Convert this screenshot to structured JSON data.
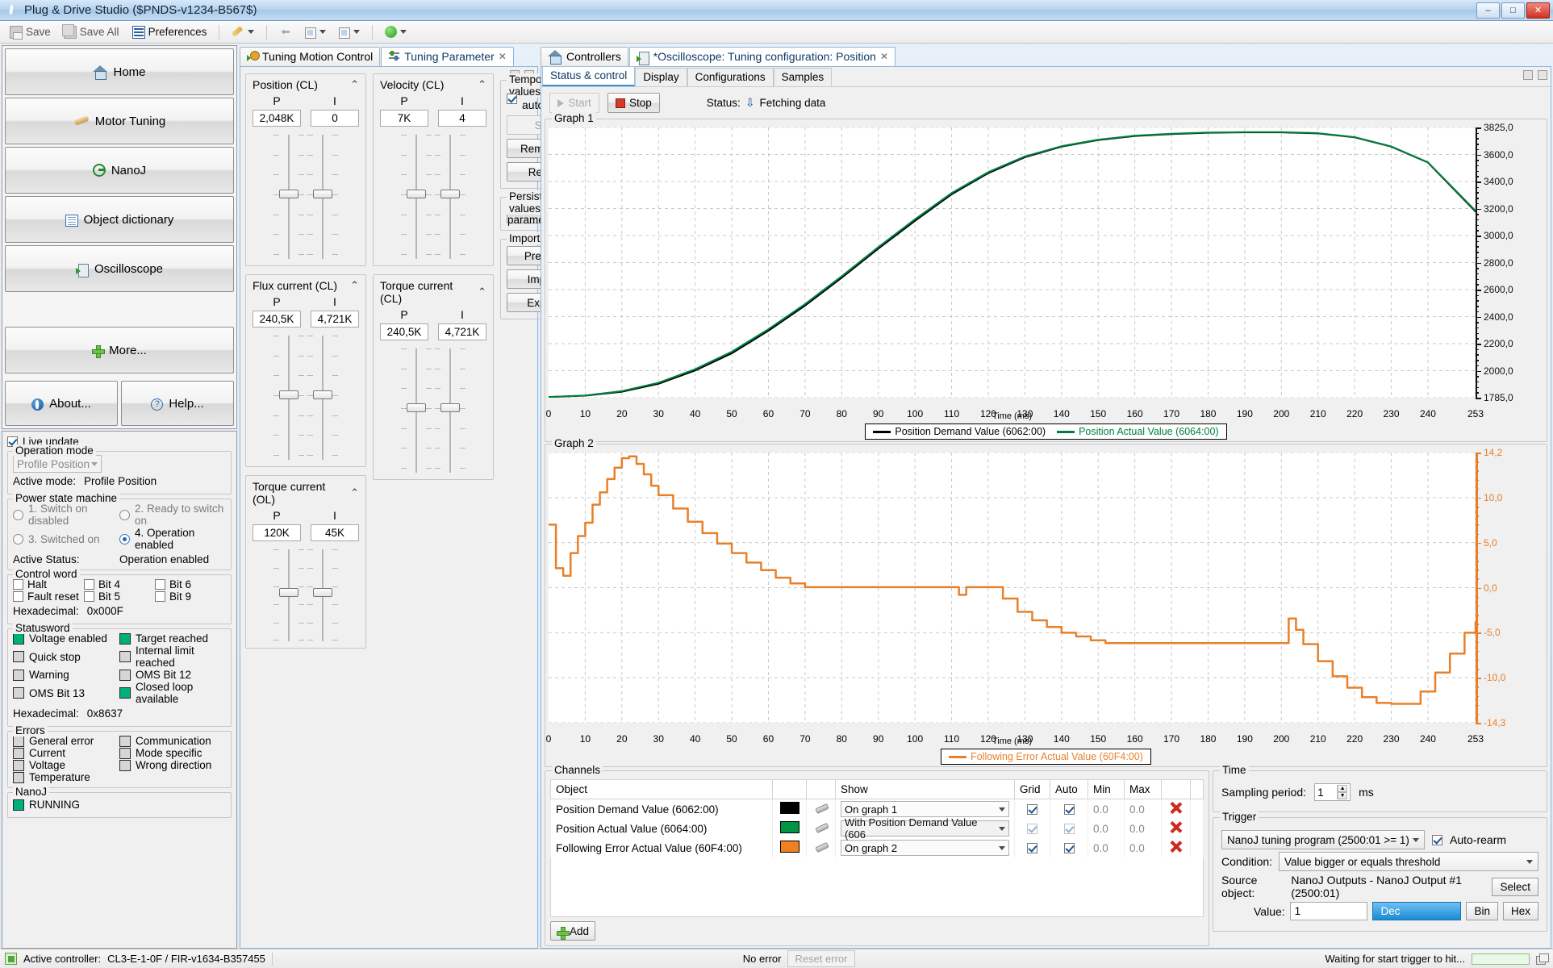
{
  "window": {
    "title": "Plug & Drive Studio ($PNDS-v1234-B567$)",
    "minimize": "–",
    "maximize": "□",
    "close": "✕"
  },
  "toolbar": {
    "save": "Save",
    "save_all": "Save All",
    "preferences": "Preferences"
  },
  "sidebar": {
    "items": [
      {
        "label": "Home",
        "icon": "home-icon"
      },
      {
        "label": "Motor Tuning",
        "icon": "wrench-icon"
      },
      {
        "label": "NanoJ",
        "icon": "nanoj-icon"
      },
      {
        "label": "Object dictionary",
        "icon": "dictionary-icon"
      },
      {
        "label": "Oscilloscope",
        "icon": "oscilloscope-icon"
      }
    ],
    "more": "More...",
    "about": "About...",
    "help": "Help..."
  },
  "state": {
    "live_update": "Live update",
    "operation_mode": {
      "legend": "Operation mode",
      "selected": "Profile Position",
      "active_mode_label": "Active mode:",
      "active_mode_value": "Profile Position"
    },
    "power_state": {
      "legend": "Power state machine",
      "options": [
        "1. Switch on disabled",
        "2. Ready to switch on",
        "3. Switched on",
        "4. Operation enabled"
      ],
      "selected_index": 3,
      "active_status_label": "Active Status:",
      "active_status_value": "Operation enabled"
    },
    "control_word": {
      "legend": "Control word",
      "items": [
        "Halt",
        "Bit 4",
        "Bit 6",
        "Fault reset",
        "Bit 5",
        "Bit 9"
      ],
      "hex_label": "Hexadecimal:",
      "hex_value": "0x000F"
    },
    "statusword": {
      "legend": "Statusword",
      "items": [
        {
          "label": "Voltage enabled",
          "on": true
        },
        {
          "label": "Target reached",
          "on": true
        },
        {
          "label": "Quick stop",
          "on": false
        },
        {
          "label": "Internal limit reached",
          "on": false
        },
        {
          "label": "Warning",
          "on": false
        },
        {
          "label": "OMS Bit 12",
          "on": false
        },
        {
          "label": "OMS Bit 13",
          "on": false
        },
        {
          "label": "Closed loop available",
          "on": true
        }
      ],
      "hex_label": "Hexadecimal:",
      "hex_value": "0x8637"
    },
    "errors": {
      "legend": "Errors",
      "items": [
        "General error",
        "Communication",
        "Current",
        "Mode specific",
        "Voltage",
        "Wrong direction",
        "Temperature"
      ]
    },
    "nanoj": {
      "legend": "NanoJ",
      "status": "RUNNING"
    }
  },
  "center_tabs": [
    {
      "label": "Tuning Motion Control",
      "active": false,
      "closable": false
    },
    {
      "label": "Tuning Parameter",
      "active": true,
      "closable": true
    }
  ],
  "tuning_groups": [
    {
      "title": "Position (CL)",
      "p_label": "P",
      "i_label": "I",
      "p_value": "2,048K",
      "i_value": "0"
    },
    {
      "title": "Velocity (CL)",
      "p_label": "P",
      "i_label": "I",
      "p_value": "7K",
      "i_value": "4"
    },
    {
      "title": "Flux current (CL)",
      "p_label": "P",
      "i_label": "I",
      "p_value": "240,5K",
      "i_value": "4,721K"
    },
    {
      "title": "Torque current (CL)",
      "p_label": "P",
      "i_label": "I",
      "p_value": "240,5K",
      "i_value": "4,721K"
    },
    {
      "title": "Torque current (OL)",
      "p_label": "P",
      "i_label": "I",
      "p_value": "120K",
      "i_value": "45K"
    }
  ],
  "side_actions": {
    "temporary": {
      "legend": "Temporary values",
      "send_auto": "Send automatically",
      "send": "Send",
      "remember": "Remember",
      "restore": "Restore"
    },
    "persistent": {
      "legend": "Persistent values",
      "save_parameters": "Save parameters"
    },
    "import_export": {
      "legend": "Import / Export",
      "presets": "Presets...",
      "import": "Import...",
      "export": "Export..."
    }
  },
  "osc_tabs": [
    {
      "label": "Controllers",
      "active": false,
      "closable": false
    },
    {
      "label": "*Oscilloscope: Tuning configuration: Position",
      "active": true,
      "closable": true
    }
  ],
  "osc_subtabs": [
    {
      "label": "Status & control",
      "active": true
    },
    {
      "label": "Display",
      "active": false
    },
    {
      "label": "Configurations",
      "active": false
    },
    {
      "label": "Samples",
      "active": false
    }
  ],
  "osc_controls": {
    "start": "Start",
    "stop": "Stop",
    "status_label": "Status:",
    "status_value": "Fetching data"
  },
  "chart_data": [
    {
      "type": "line",
      "title": "Graph 1",
      "xlabel": "Time (ms)",
      "ylabel": "",
      "xlim": [
        0,
        253
      ],
      "ylim": [
        1785.0,
        3825.0
      ],
      "xticks": [
        0,
        10,
        20,
        30,
        40,
        50,
        60,
        70,
        80,
        90,
        100,
        110,
        120,
        130,
        140,
        150,
        160,
        170,
        180,
        190,
        200,
        210,
        220,
        230,
        240,
        253
      ],
      "yticks": [
        "3825,0",
        "3600,0",
        "3400,0",
        "3200,0",
        "3000,0",
        "2800,0",
        "2600,0",
        "2400,0",
        "2200,0",
        "2000,0",
        "1785,0"
      ],
      "grid": true,
      "legend_position": "bottom",
      "series": [
        {
          "name": "Position Demand Value (6062:00)",
          "color": "#000000",
          "x": [
            0,
            10,
            20,
            30,
            40,
            50,
            60,
            70,
            80,
            90,
            100,
            110,
            120,
            130,
            140,
            150,
            160,
            170,
            180,
            190,
            200,
            210,
            220,
            230,
            240,
            253
          ],
          "y": [
            1790,
            1800,
            1830,
            1890,
            1990,
            2120,
            2290,
            2480,
            2690,
            2910,
            3120,
            3320,
            3480,
            3600,
            3680,
            3730,
            3760,
            3775,
            3785,
            3788,
            3788,
            3780,
            3750,
            3680,
            3560,
            3190
          ]
        },
        {
          "name": "Position Actual Value (6064:00)",
          "color": "#008040",
          "x": [
            0,
            10,
            20,
            30,
            40,
            50,
            60,
            70,
            80,
            90,
            100,
            110,
            120,
            130,
            140,
            150,
            160,
            170,
            180,
            190,
            200,
            210,
            220,
            230,
            240,
            253
          ],
          "y": [
            1790,
            1802,
            1835,
            1898,
            2000,
            2132,
            2302,
            2492,
            2702,
            2922,
            3132,
            3330,
            3488,
            3606,
            3684,
            3733,
            3763,
            3778,
            3787,
            3790,
            3790,
            3782,
            3752,
            3682,
            3562,
            3196
          ]
        }
      ]
    },
    {
      "type": "line",
      "title": "Graph 2",
      "xlabel": "Time (ms)",
      "ylabel": "",
      "xlim": [
        0,
        253
      ],
      "ylim": [
        -14.3,
        14.2
      ],
      "xticks": [
        0,
        10,
        20,
        30,
        40,
        50,
        60,
        70,
        80,
        90,
        100,
        110,
        120,
        130,
        140,
        150,
        160,
        170,
        180,
        190,
        200,
        210,
        220,
        230,
        240,
        253
      ],
      "yticks": [
        "14,2",
        "10,0",
        "5,0",
        "0,0",
        "-5,0",
        "-10,0",
        "-14,3"
      ],
      "grid": true,
      "legend_position": "bottom",
      "series": [
        {
          "name": "Following Error Actual Value (60F4:00)",
          "color": "#E8802A",
          "x": [
            0,
            2,
            4,
            6,
            8,
            10,
            12,
            14,
            16,
            18,
            20,
            22,
            24,
            26,
            28,
            30,
            34,
            38,
            42,
            46,
            50,
            54,
            58,
            62,
            66,
            70,
            74,
            78,
            82,
            86,
            90,
            100,
            110,
            112,
            114,
            120,
            124,
            128,
            132,
            136,
            140,
            144,
            148,
            152,
            160,
            170,
            180,
            190,
            200,
            202,
            204,
            206,
            210,
            214,
            218,
            222,
            226,
            230,
            234,
            238,
            242,
            246,
            250,
            253
          ],
          "y": [
            6.6,
            2.0,
            1.2,
            3.6,
            5.4,
            6.8,
            8.7,
            10.0,
            11.4,
            12.6,
            13.6,
            13.8,
            13.0,
            11.9,
            10.7,
            9.7,
            8.3,
            6.9,
            5.7,
            4.6,
            3.6,
            2.6,
            1.8,
            1.0,
            0.4,
            0.0,
            0.0,
            0.0,
            0.0,
            0.0,
            0.0,
            0.0,
            0.0,
            -0.8,
            0.0,
            0.0,
            -1.2,
            -2.6,
            -3.5,
            -4.2,
            -4.8,
            -5.2,
            -5.6,
            -5.9,
            -5.9,
            -5.9,
            -5.9,
            -5.9,
            -5.9,
            -3.3,
            -4.5,
            -6.0,
            -7.8,
            -9.4,
            -10.6,
            -11.6,
            -12.2,
            -12.3,
            -12.3,
            -11.0,
            -9.0,
            -7.0,
            -4.8,
            -3.6
          ]
        }
      ]
    }
  ],
  "channels": {
    "legend": "Channels",
    "headers": [
      "Object",
      "",
      "",
      "Show",
      "Grid",
      "Auto",
      "Min",
      "Max",
      "",
      ""
    ],
    "rows": [
      {
        "object": "Position Demand Value (6062:00)",
        "color": "#000000",
        "show": "On graph 1",
        "grid": true,
        "auto": true,
        "min": "0.0",
        "max": "0.0",
        "enabled": true
      },
      {
        "object": "Position Actual Value (6064:00)",
        "color": "#009444",
        "show": "With Position Demand Value (606",
        "grid": true,
        "auto": true,
        "min": "0.0",
        "max": "0.0",
        "enabled": false
      },
      {
        "object": "Following Error Actual Value (60F4:00)",
        "color": "#F08020",
        "show": "On graph 2",
        "grid": true,
        "auto": true,
        "min": "0.0",
        "max": "0.0",
        "enabled": true
      }
    ],
    "add": "Add"
  },
  "time_panel": {
    "legend": "Time",
    "sampling_label": "Sampling period:",
    "sampling_value": "1",
    "unit": "ms"
  },
  "trigger_panel": {
    "legend": "Trigger",
    "trigger_source": "NanoJ tuning program (2500:01 >= 1)",
    "auto_rearm": "Auto-rearm",
    "condition_label": "Condition:",
    "condition_value": "Value bigger or equals threshold",
    "source_label": "Source object:",
    "source_value": "NanoJ Outputs - NanoJ Output #1 (2500:01)",
    "select": "Select",
    "value_label": "Value:",
    "value": "1",
    "radix": [
      "Dec",
      "Bin",
      "Hex"
    ],
    "radix_selected": "Dec"
  },
  "statusbar": {
    "controller_label": "Active controller:",
    "controller_value": "CL3-E-1-0F / FIR-v1634-B357455",
    "no_error": "No error",
    "reset_error": "Reset error",
    "task": "Waiting for start trigger to hit..."
  }
}
